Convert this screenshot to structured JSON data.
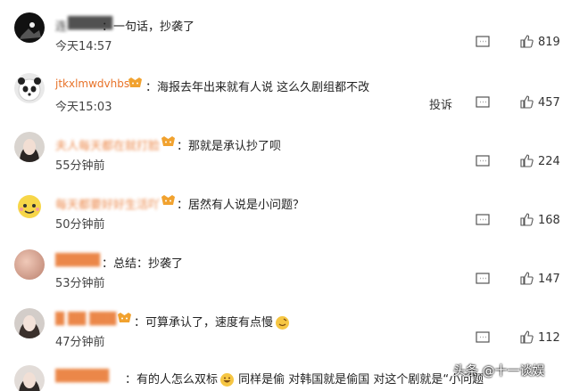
{
  "comments": [
    {
      "user": "连",
      "text": "一句话，抄袭了",
      "time": "今天14:57",
      "likes": "819"
    },
    {
      "user": "jtkxlmwdvhbsl",
      "text": "海报去年出来就有人说 这么久剧组都不改",
      "time": "今天15:03",
      "likes": "457",
      "report_label": "投诉"
    },
    {
      "user": "夫人每天都在就打脸",
      "text": "那就是承认抄了呗",
      "time": "55分钟前",
      "likes": "224"
    },
    {
      "user": "每天都要好好生活吖",
      "text": "居然有人说是小问题？",
      "time": "50分钟前",
      "likes": "168"
    },
    {
      "user": "",
      "text": "总结：抄袭了",
      "time": "53分钟前",
      "likes": "147"
    },
    {
      "user": "",
      "text": "可算承认了，速度有点慢",
      "time": "47分钟前",
      "likes": "112"
    },
    {
      "user": "",
      "text": "有的人怎么双标",
      "text2": "同样是偷  对韩国就是偷国  对这个剧就是“小问题",
      "time": "",
      "likes": ""
    }
  ],
  "watermark": "头条 @十一谈娱",
  "colors": {
    "orange": "#e8732a",
    "text": "#222222",
    "muted": "#444444"
  },
  "icons": [
    "message-icon",
    "like-icon",
    "vip-badge-icon",
    "smile-emoji-icon"
  ]
}
